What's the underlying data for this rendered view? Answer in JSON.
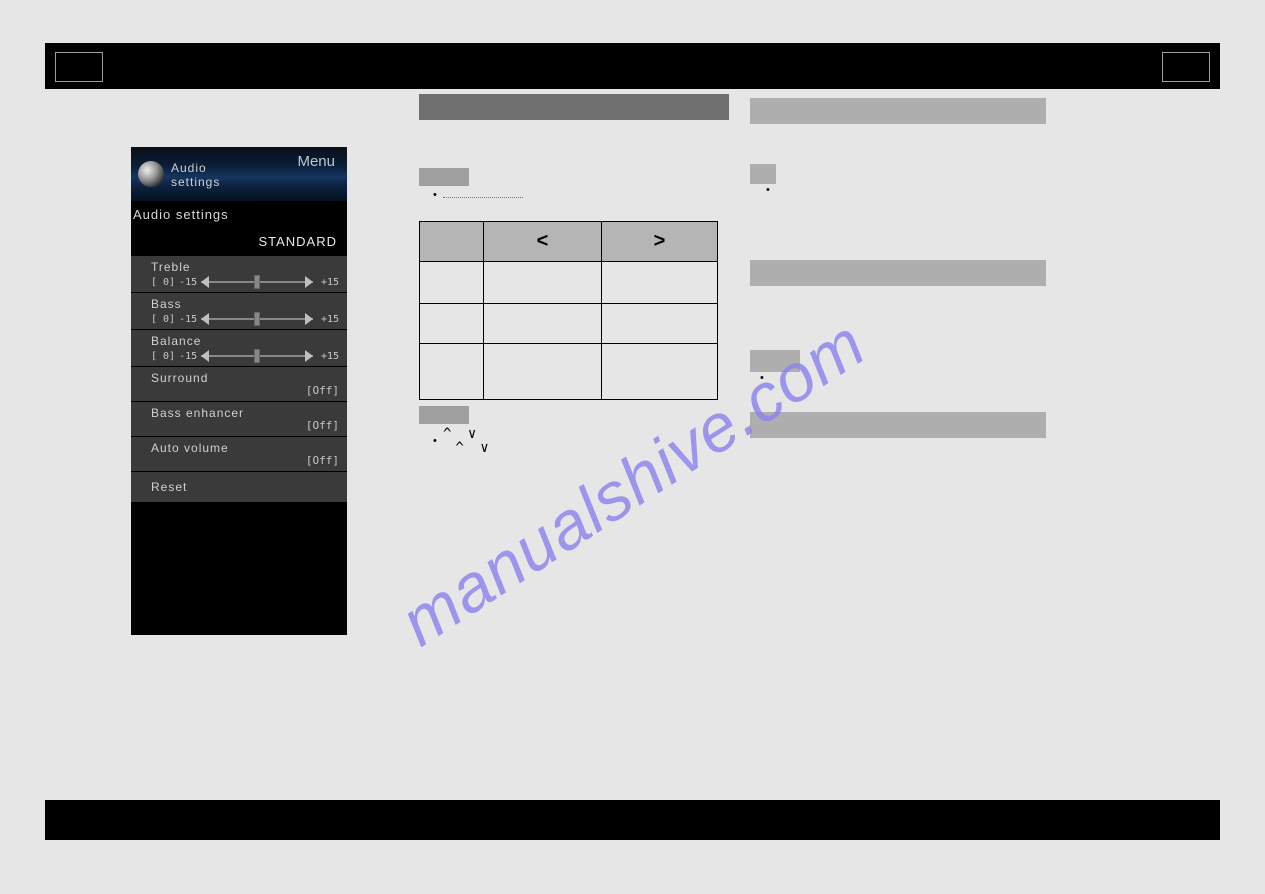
{
  "watermark": "manualshive.com",
  "osd": {
    "menu_label": "Menu",
    "header_small_l1": "Audio",
    "header_small_l2": "settings",
    "section_title": "Audio settings",
    "preset": "STANDARD",
    "sliders": [
      {
        "label": "Treble",
        "current": "[   0]",
        "min": "-15",
        "max": "+15"
      },
      {
        "label": "Bass",
        "current": "[   0]",
        "min": "-15",
        "max": "+15"
      },
      {
        "label": "Balance",
        "current": "[   0]",
        "min": "-15",
        "max": "+15"
      }
    ],
    "toggles": [
      {
        "label": "Surround",
        "state": "Off"
      },
      {
        "label": "Bass enhancer",
        "state": "Off"
      },
      {
        "label": "Auto volume",
        "state": "Off"
      }
    ],
    "reset_label": "Reset"
  },
  "mid": {
    "dir_left": "<",
    "dir_right": ">",
    "carets": "^ v\n ^ v"
  }
}
